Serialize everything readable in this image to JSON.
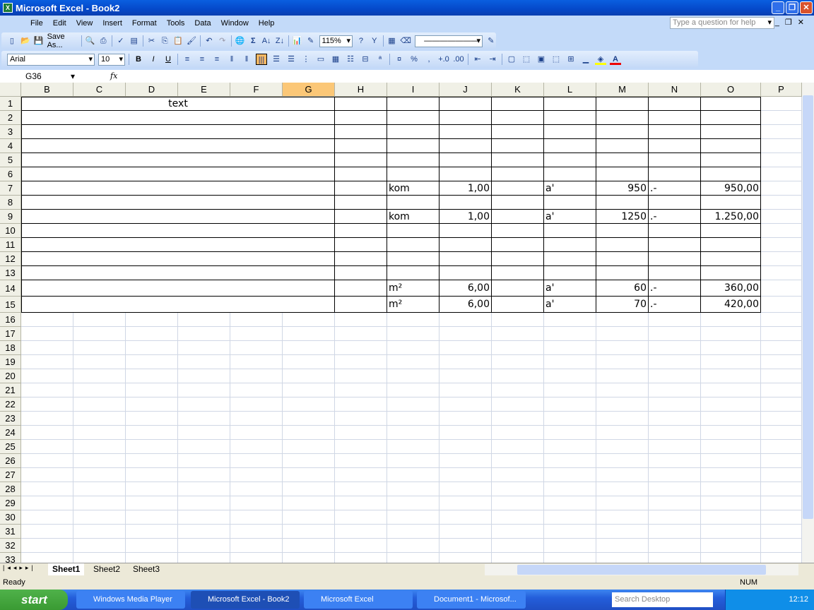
{
  "window": {
    "title": "Microsoft Excel - Book2"
  },
  "menu": [
    "File",
    "Edit",
    "View",
    "Insert",
    "Format",
    "Tools",
    "Data",
    "Window",
    "Help"
  ],
  "help_placeholder": "Type a question for help",
  "toolbar": {
    "save_as": "Save As...",
    "zoom": "115%",
    "font": "Arial",
    "size": "10",
    "bold": "B",
    "italic": "I",
    "underline": "U",
    "percent": "%",
    "comma": ","
  },
  "formula": {
    "name_box": "G36",
    "fx": "fx",
    "value": ""
  },
  "columns": [
    "B",
    "C",
    "D",
    "E",
    "F",
    "G",
    "H",
    "I",
    "J",
    "K",
    "L",
    "M",
    "N",
    "O",
    "P"
  ],
  "selected_column": "G",
  "rows": [
    1,
    2,
    3,
    4,
    5,
    6,
    7,
    8,
    9,
    10,
    11,
    12,
    13,
    14,
    15,
    16,
    17,
    18,
    19,
    20,
    21,
    22,
    23,
    24,
    25,
    26,
    27,
    28,
    29,
    30,
    31,
    32,
    33
  ],
  "cells": {
    "B1": "text",
    "I7": "kom",
    "J7": "1,00",
    "L7": "a'",
    "M7": "950",
    "N7": ".-",
    "O7": "950,00",
    "I9": "kom",
    "J9": "1,00",
    "L9": "a'",
    "M9": "1250",
    "N9": ".-",
    "O9": "1.250,00",
    "I14": "m²",
    "J14": "6,00",
    "L14": "a'",
    "M14": "60",
    "N14": ".-",
    "O14": "360,00",
    "I15": "m²",
    "J15": "6,00",
    "L15": "a'",
    "M15": "70",
    "N15": ".-",
    "O15": "420,00"
  },
  "sheets": [
    "Sheet1",
    "Sheet2",
    "Sheet3"
  ],
  "active_sheet": "Sheet1",
  "status": {
    "left": "Ready",
    "num": "NUM"
  },
  "taskbar": {
    "start": "start",
    "tasks": [
      "Windows Media Player",
      "Microsoft Excel - Book2",
      "Microsoft Excel",
      "Document1 - Microsof..."
    ],
    "active_task": 1,
    "search": "Search Desktop",
    "clock": "12:12"
  }
}
